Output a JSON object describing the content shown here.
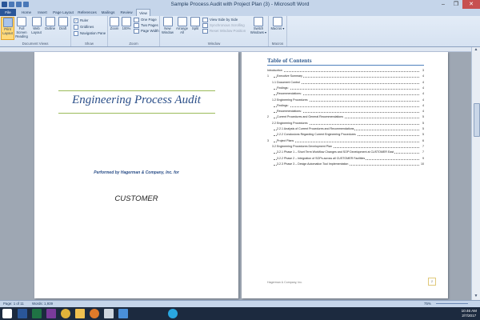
{
  "window": {
    "title": "Sample Process Audit with Project Plan (3) - Microsoft Word",
    "minimize": "–",
    "maximize": "❐",
    "close": "✕"
  },
  "tabs": [
    "File",
    "Home",
    "Insert",
    "Page Layout",
    "References",
    "Mailings",
    "Review",
    "View"
  ],
  "ribbon": {
    "document_views": {
      "label": "Document Views",
      "buttons": [
        "Print Layout",
        "Full Screen Reading",
        "Web Layout",
        "Outline",
        "Draft"
      ]
    },
    "show": {
      "label": "Show",
      "checkboxes": [
        {
          "label": "Ruler",
          "checked": true
        },
        {
          "label": "Gridlines",
          "checked": false
        },
        {
          "label": "Navigation Pane",
          "checked": false
        }
      ]
    },
    "zoom": {
      "label": "Zoom",
      "zoom_btn": "Zoom",
      "percent_btn": "100%",
      "one_page": "One Page",
      "two_pages": "Two Pages",
      "page_width": "Page Width"
    },
    "window": {
      "label": "Window",
      "new_window": "New Window",
      "arrange_all": "Arrange All",
      "split": "Split",
      "side_by_side": "View Side by Side",
      "sync_scroll": "Synchronous Scrolling",
      "reset_position": "Reset Window Position",
      "switch_windows": "Switch Windows ▾"
    },
    "macros": {
      "label": "Macros",
      "macros_btn": "Macros ▾"
    }
  },
  "page1": {
    "title": "Engineering Process Audit",
    "performed_by": "Performed by Hagerman & Company, Inc. for",
    "customer": "CUSTOMER"
  },
  "page2": {
    "toc_heading": "Table of Contents",
    "toc": [
      {
        "num": "",
        "text": "Introduction",
        "page": "3",
        "indent": 0
      },
      {
        "num": "1",
        "text": "Executive Summary",
        "page": "4",
        "indent": 0
      },
      {
        "num": "",
        "text": "1.1 Document Control",
        "page": "4",
        "indent": 1
      },
      {
        "num": "",
        "text": "Findings:",
        "page": "4",
        "indent": 2
      },
      {
        "num": "",
        "text": "Recommendations:",
        "page": "4",
        "indent": 2
      },
      {
        "num": "",
        "text": "1.2 Engineering Procedures",
        "page": "4",
        "indent": 1
      },
      {
        "num": "",
        "text": "Findings:",
        "page": "4",
        "indent": 2
      },
      {
        "num": "",
        "text": "Recommendations:",
        "page": "4",
        "indent": 2
      },
      {
        "num": "2",
        "text": "Current Procedures and General Recommendations",
        "page": "5",
        "indent": 0
      },
      {
        "num": "",
        "text": "2.2 Engineering Procedures",
        "page": "5",
        "indent": 1
      },
      {
        "num": "",
        "text": "2.2.1 Analysis of Current Procedures and Recommendations",
        "page": "5",
        "indent": 2
      },
      {
        "num": "",
        "text": "2.2.2 Conclusions Regarding Current Engineering Procedures",
        "page": "5",
        "indent": 2
      },
      {
        "num": "3",
        "text": "Project Plans",
        "page": "6",
        "indent": 0
      },
      {
        "num": "",
        "text": "3.2 Engineering Procedures Development Plan",
        "page": "7",
        "indent": 1
      },
      {
        "num": "",
        "text": "3.2.1 Phase 1 – Short Term Workflow Changes and SOP Development at CUSTOMER East",
        "page": "7",
        "indent": 2
      },
      {
        "num": "",
        "text": "3.2.2 Phase 2 – Integration of SOPs across all CUSTOMER Facilities",
        "page": "9",
        "indent": 2
      },
      {
        "num": "",
        "text": "3.2.3 Phase 3 – Design Automation Tool Implementation",
        "page": "10",
        "indent": 2
      }
    ],
    "footer_company": "Hagerman & Company, Inc.",
    "footer_page": "2"
  },
  "status": {
    "page": "Page: 1 of 11",
    "words": "Words: 1,939",
    "zoom": "75%"
  },
  "taskbar": {
    "time": "10:46 AM",
    "date": "2/7/2017",
    "icons": [
      "start-icon",
      "word-icon",
      "excel-icon",
      "onenote-icon",
      "chrome-icon",
      "explorer-icon",
      "firefox-icon",
      "notepad-icon",
      "paint-icon",
      "skype-icon"
    ]
  },
  "colors": {
    "accent": "#2a5699",
    "title_blue": "#2a4e88",
    "toc_heading": "#365f91",
    "title_rule": "#9bbb59"
  }
}
